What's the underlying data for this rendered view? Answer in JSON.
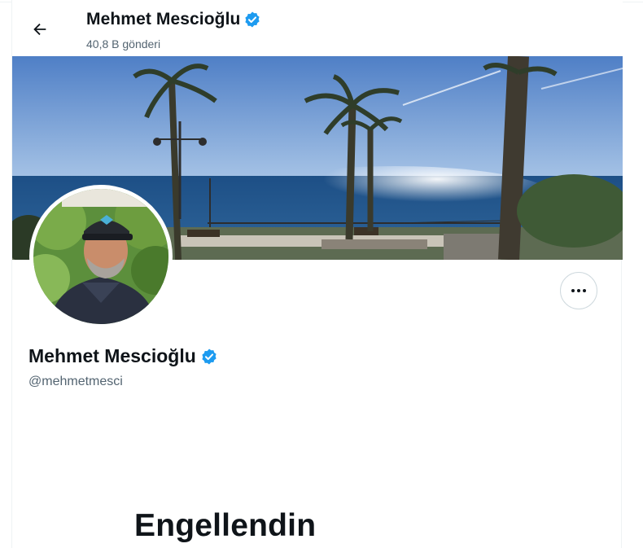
{
  "header": {
    "name": "Mehmet Mescioğlu",
    "post_count": "40,8 B gönderi",
    "back_icon": "arrow-left-icon",
    "verified_icon": "verified-badge-icon"
  },
  "profile": {
    "name": "Mehmet Mescioğlu",
    "handle": "@mehmetmesci",
    "verified_icon": "verified-badge-icon",
    "more_icon": "more-horizontal-icon"
  },
  "blocked": {
    "title": "Engellendin"
  },
  "colors": {
    "verified": "#1d9bf0",
    "text_primary": "#0f1419",
    "text_secondary": "#536471",
    "border": "#eff3f4"
  }
}
